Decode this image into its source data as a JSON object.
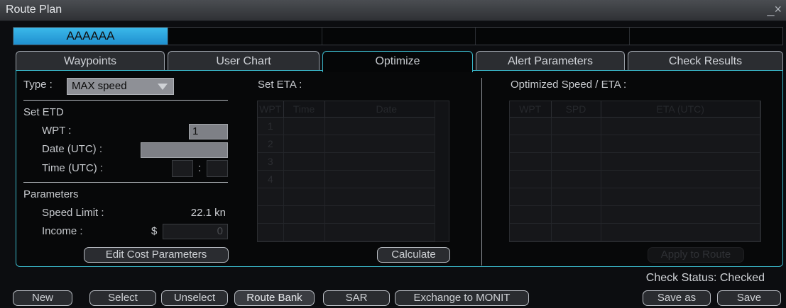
{
  "window": {
    "title": "Route Plan",
    "close_glyph": "_×"
  },
  "route_bar": {
    "selected": "AAAAAA"
  },
  "tabs": [
    "Waypoints",
    "User Chart",
    "Optimize",
    "Alert Parameters",
    "Check Results"
  ],
  "left": {
    "type_label": "Type :",
    "type_value": "MAX speed",
    "set_etd": "Set ETD",
    "wpt_label": "WPT :",
    "wpt_value": "1",
    "date_label": "Date (UTC) :",
    "time_label": "Time (UTC) :",
    "time_sep": ":",
    "parameters": "Parameters",
    "speed_label": "Speed Limit :",
    "speed_value": "22.1 kn",
    "income_label": "Income :",
    "currency": "$",
    "income_value": "0",
    "edit_cost_button": "Edit Cost Parameters"
  },
  "set_eta": {
    "title": "Set ETA :",
    "columns": [
      "WPT",
      "Time",
      "Date"
    ],
    "rows": [
      "1",
      "2",
      "3",
      "4"
    ],
    "calculate_button": "Calculate"
  },
  "optimized": {
    "title": "Optimized Speed / ETA :",
    "columns": [
      "WPT",
      "SPD",
      "ETA (UTC)"
    ],
    "apply_button": "Apply to Route"
  },
  "status": {
    "check_status": "Check Status: Checked"
  },
  "bottom_buttons": {
    "new": "New",
    "select": "Select",
    "unselect": "Unselect",
    "route_bank": "Route Bank",
    "sar": "SAR",
    "exchange": "Exchange to MONIT",
    "save_as": "Save as",
    "save": "Save"
  }
}
